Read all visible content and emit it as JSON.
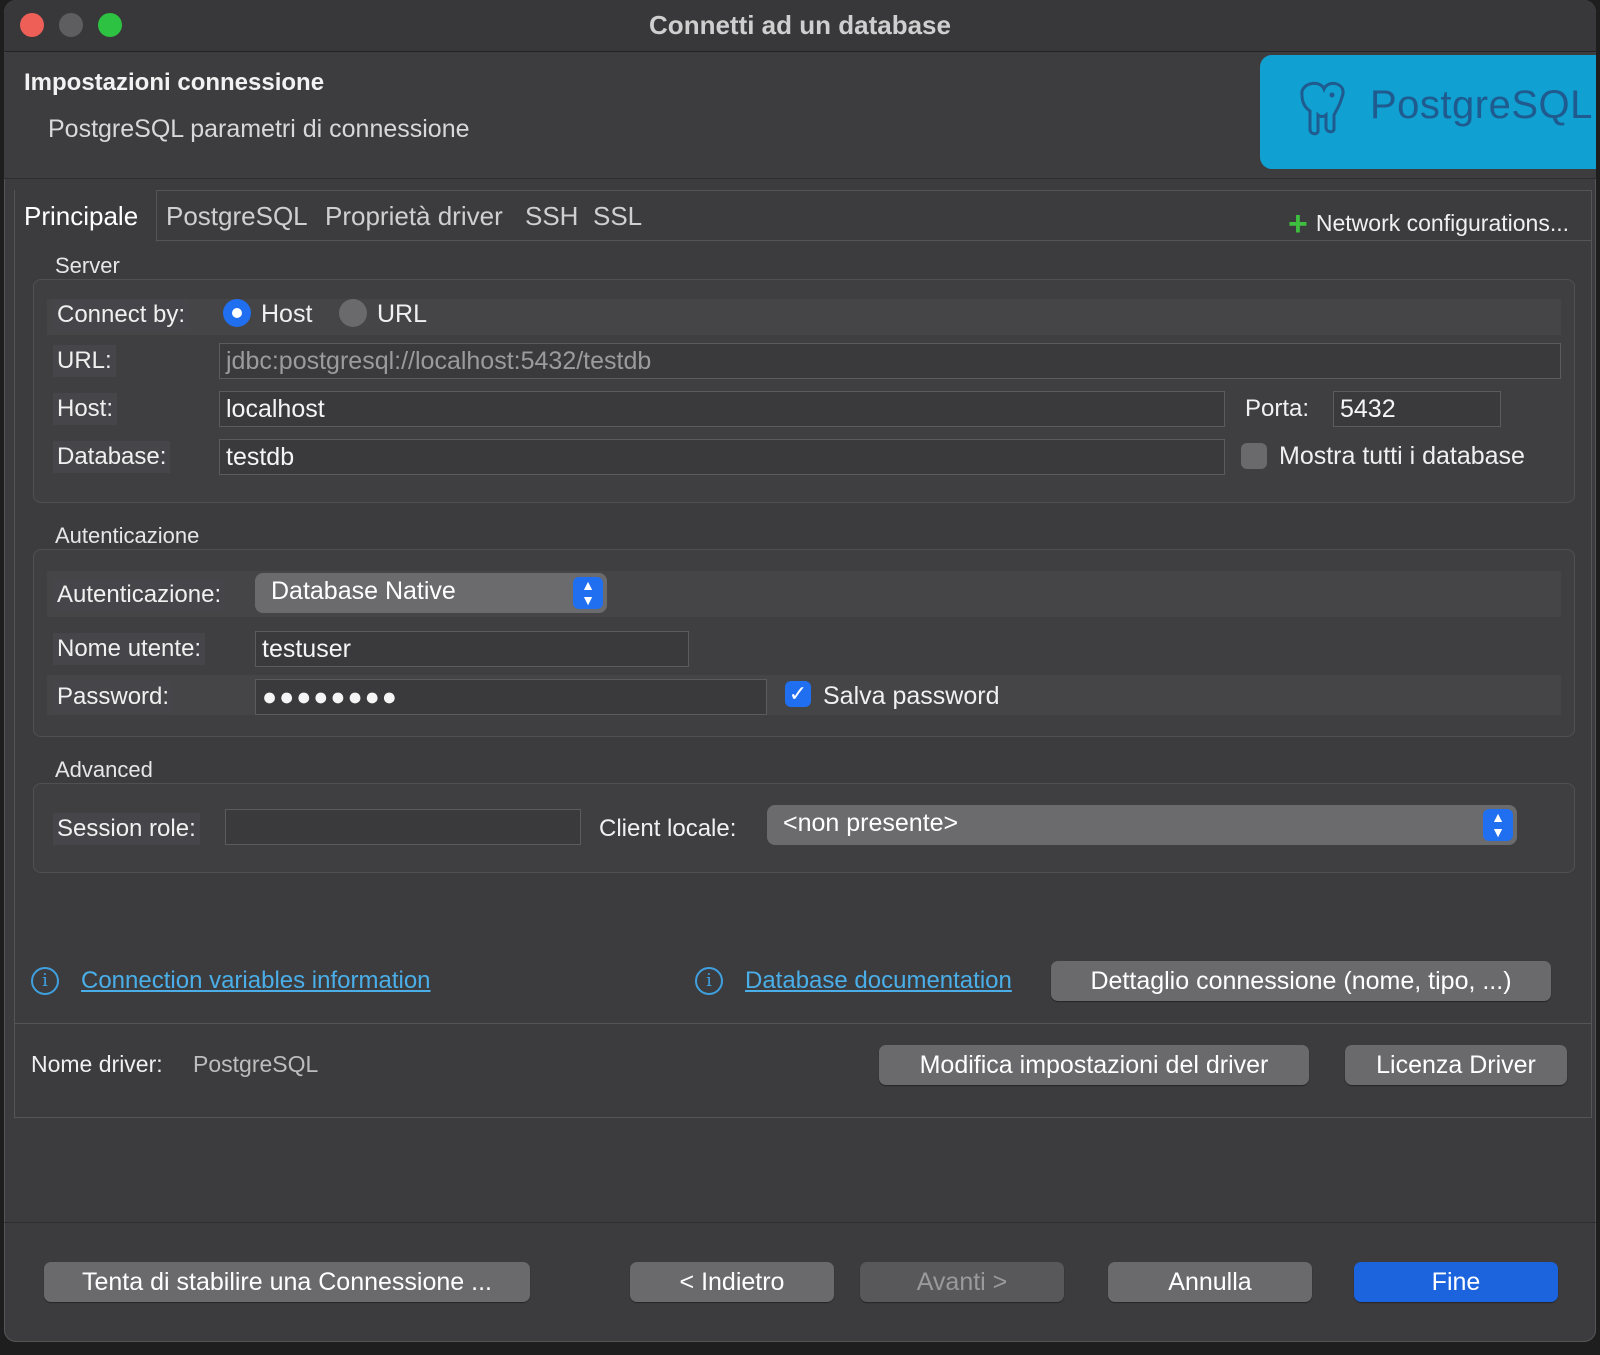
{
  "window": {
    "title": "Connetti ad un database"
  },
  "header": {
    "title": "Impostazioni connessione",
    "subtitle": "PostgreSQL parametri di connessione",
    "logo_text": "PostgreSQL"
  },
  "tabs": [
    {
      "label": "Principale",
      "active": true
    },
    {
      "label": "PostgreSQL"
    },
    {
      "label": "Proprietà driver"
    },
    {
      "label": "SSH"
    },
    {
      "label": "SSL"
    }
  ],
  "network_config_label": "Network configurations...",
  "server": {
    "group_label": "Server",
    "connect_by_label": "Connect by:",
    "connect_by_options": [
      "Host",
      "URL"
    ],
    "connect_by_selected": "Host",
    "url_label": "URL:",
    "url_value": "jdbc:postgresql://localhost:5432/testdb",
    "host_label": "Host:",
    "host_value": "localhost",
    "port_label": "Porta:",
    "port_value": "5432",
    "database_label": "Database:",
    "database_value": "testdb",
    "show_all_label": "Mostra tutti i database",
    "show_all_checked": false
  },
  "auth": {
    "group_label": "Autenticazione",
    "auth_label": "Autenticazione:",
    "auth_value": "Database Native",
    "user_label": "Nome utente:",
    "user_value": "testuser",
    "password_label": "Password:",
    "password_value": "●●●●●●●●",
    "save_password_label": "Salva password",
    "save_password_checked": true
  },
  "advanced": {
    "group_label": "Advanced",
    "session_role_label": "Session role:",
    "session_role_value": "",
    "client_locale_label": "Client locale:",
    "client_locale_value": "<non presente>"
  },
  "links": {
    "conn_vars": "Connection variables information",
    "db_docs": "Database documentation",
    "details_button": "Dettaglio connessione (nome, tipo, ...)"
  },
  "driver": {
    "label": "Nome driver:",
    "value": "PostgreSQL",
    "edit_button": "Modifica impostazioni del driver",
    "license_button": "Licenza Driver"
  },
  "footer": {
    "test_button": "Tenta di stabilire una Connessione ...",
    "back_button": "< Indietro",
    "next_button": "Avanti >",
    "cancel_button": "Annulla",
    "finish_button": "Fine"
  },
  "colors": {
    "accent": "#1f6ff0",
    "logo_bg": "#10a0d2",
    "link": "#4aaee8",
    "plus": "#3fbf3f"
  }
}
